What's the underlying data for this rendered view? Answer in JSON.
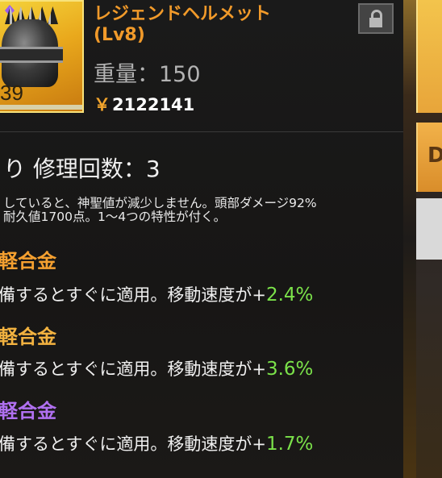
{
  "item": {
    "name": "レジェンドヘルメット",
    "level": "(Lv8)",
    "weight": "重量：150",
    "price_symbol": "￥",
    "price": "2122141",
    "icon_count": "39",
    "icon_name": "helmet-icon"
  },
  "repair": "り 修理回数：3",
  "description": [
    "していると、神聖値が減少しません。頭部ダメージ92%",
    "耐久値1700点。1～4つの特性が付く。"
  ],
  "traits": [
    {
      "name": "軽合金",
      "name_color": "#f5a030",
      "text": "備するとすぐに適用。移動速度が",
      "plus": "+",
      "value": "2.4%"
    },
    {
      "name": "軽合金",
      "name_color": "#f2b240",
      "text": "備するとすぐに適用。移動速度が",
      "plus": "+",
      "value": "3.6%"
    },
    {
      "name": "軽合金",
      "name_color": "#b070f0",
      "text": "備するとすぐに適用。移動速度が",
      "plus": "+",
      "value": "1.7%"
    }
  ],
  "right_panel": {
    "button2_glyph": "D"
  },
  "colors": {
    "accent": "#f19a2a",
    "value_green": "#7be24a"
  }
}
